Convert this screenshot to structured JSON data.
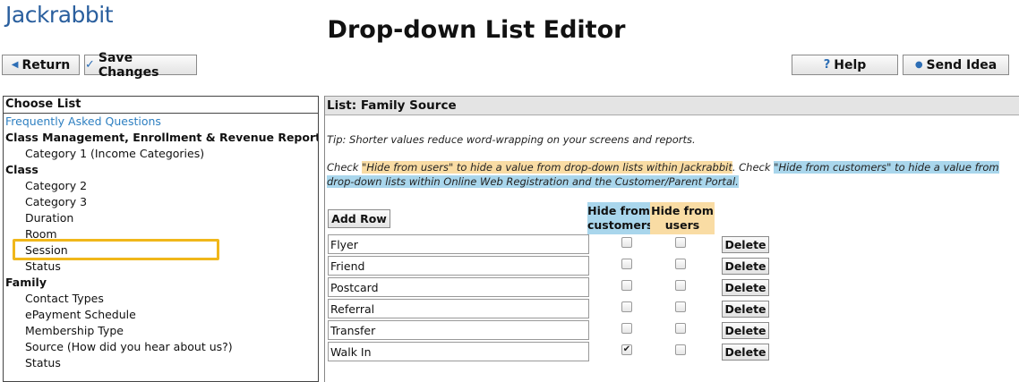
{
  "header": {
    "logo": "Jackrabbit",
    "title": "Drop-down List Editor"
  },
  "toolbar": {
    "return_label": "Return",
    "save_label": "Save Changes",
    "help_label": "Help",
    "send_idea_label": "Send Idea"
  },
  "left_panel": {
    "header": "Choose List",
    "rows": [
      {
        "type": "link",
        "label": "Frequently Asked Questions"
      },
      {
        "type": "group",
        "label": "Class Management, Enrollment & Revenue Reporting"
      },
      {
        "type": "item",
        "label": "Category 1 (Income Categories)"
      },
      {
        "type": "group",
        "label": "Class"
      },
      {
        "type": "item",
        "label": "Category 2"
      },
      {
        "type": "item",
        "label": "Category 3"
      },
      {
        "type": "item",
        "label": "Duration"
      },
      {
        "type": "item",
        "label": "Room"
      },
      {
        "type": "item",
        "label": "Session"
      },
      {
        "type": "item",
        "label": "Status"
      },
      {
        "type": "group",
        "label": "Family"
      },
      {
        "type": "item",
        "label": "Contact Types"
      },
      {
        "type": "item",
        "label": "ePayment Schedule"
      },
      {
        "type": "item",
        "label": "Membership Type"
      },
      {
        "type": "item",
        "label": "Source (How did you hear about us?)",
        "highlighted": true
      },
      {
        "type": "item",
        "label": "Status"
      }
    ]
  },
  "right_panel": {
    "header": "List: Family Source",
    "tip": "Tip: Shorter values reduce word-wrapping on your screens and reports.",
    "check_note": {
      "prefix": "Check ",
      "users_part": "\"Hide from users\" to hide a value from drop-down lists within Jackrabbit",
      "middle": ". Check ",
      "customers_part": "\"Hide from customers\" to hide a value from drop-down lists within Online Web Registration and the Customer/Parent Portal. "
    },
    "add_row_label": "Add Row",
    "col_hide_customers": "Hide from customers",
    "col_hide_users": "Hide from users",
    "delete_label": "Delete",
    "rows": [
      {
        "value": "Flyer",
        "hide_customers": false,
        "hide_users": false
      },
      {
        "value": "Friend",
        "hide_customers": false,
        "hide_users": false
      },
      {
        "value": "Postcard",
        "hide_customers": false,
        "hide_users": false
      },
      {
        "value": "Referral",
        "hide_customers": false,
        "hide_users": false
      },
      {
        "value": "Transfer",
        "hide_customers": false,
        "hide_users": false
      },
      {
        "value": "Walk In",
        "hide_customers": true,
        "hide_users": false
      }
    ]
  },
  "colors": {
    "brand": "#2a5f9e",
    "link": "#2d7fc1",
    "highlight_orange": "#f9dca4",
    "highlight_blue": "#a9d6ec",
    "callout_border": "#f0b71a"
  },
  "icons": {
    "return": "triangle-left-icon",
    "save": "checkmark-icon",
    "help": "question-icon",
    "send_idea": "lightbulb-icon"
  }
}
